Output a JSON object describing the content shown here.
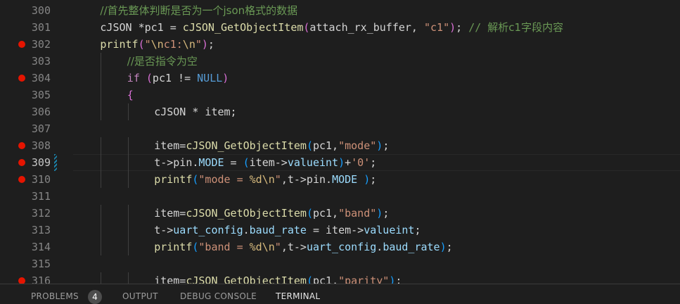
{
  "editor": {
    "lines": [
      {
        "number": "300",
        "breakpoint": false,
        "indent": "    ",
        "segments": [
          {
            "t": "//首先整体判断是否为一个json格式的数据",
            "c": "cm"
          }
        ]
      },
      {
        "number": "301",
        "breakpoint": false,
        "indent": "    ",
        "segments": [
          {
            "t": "cJSON *pc1 = ",
            "c": ""
          },
          {
            "t": "cJSON_GetObjectItem",
            "c": "fn"
          },
          {
            "t": "(",
            "c": "br"
          },
          {
            "t": "attach_rx_buffer, ",
            "c": ""
          },
          {
            "t": "\"c1\"",
            "c": "st"
          },
          {
            "t": ")",
            "c": "br"
          },
          {
            "t": "; ",
            "c": ""
          },
          {
            "t": "// ",
            "c": "cmm"
          },
          {
            "t": "解析c1字段内容",
            "c": "cm"
          }
        ]
      },
      {
        "number": "302",
        "breakpoint": true,
        "indent": "    ",
        "segments": [
          {
            "t": "printf",
            "c": "fn"
          },
          {
            "t": "(",
            "c": "br"
          },
          {
            "t": "\"",
            "c": "st"
          },
          {
            "t": "\\n",
            "c": "esc"
          },
          {
            "t": "c1:",
            "c": "st"
          },
          {
            "t": "\\n",
            "c": "esc"
          },
          {
            "t": "\"",
            "c": "st"
          },
          {
            "t": ")",
            "c": "br"
          },
          {
            "t": ";",
            "c": ""
          }
        ]
      },
      {
        "number": "303",
        "breakpoint": false,
        "indent": "        ",
        "segments": [
          {
            "t": "//是否指令为空",
            "c": "cm"
          }
        ]
      },
      {
        "number": "304",
        "breakpoint": true,
        "indent": "        ",
        "segments": [
          {
            "t": "if",
            "c": "kw"
          },
          {
            "t": " (",
            "c": "br"
          },
          {
            "t": "pc1 != ",
            "c": ""
          },
          {
            "t": "NULL",
            "c": "cn"
          },
          {
            "t": ")",
            "c": "br"
          }
        ]
      },
      {
        "number": "305",
        "breakpoint": false,
        "indent": "        ",
        "segments": [
          {
            "t": "{",
            "c": "br"
          }
        ]
      },
      {
        "number": "306",
        "breakpoint": false,
        "indent": "            ",
        "segments": [
          {
            "t": "cJSON * item;",
            "c": ""
          }
        ]
      },
      {
        "number": "307",
        "breakpoint": false,
        "indent": "",
        "segments": []
      },
      {
        "number": "308",
        "breakpoint": true,
        "indent": "            ",
        "segments": [
          {
            "t": "item=",
            "c": ""
          },
          {
            "t": "cJSON_GetObjectItem",
            "c": "fn"
          },
          {
            "t": "(",
            "c": "bl"
          },
          {
            "t": "pc1,",
            "c": ""
          },
          {
            "t": "\"mode\"",
            "c": "st"
          },
          {
            "t": ")",
            "c": "bl"
          },
          {
            "t": ";",
            "c": ""
          }
        ]
      },
      {
        "number": "309",
        "breakpoint": true,
        "active": true,
        "modified": true,
        "indent": "            ",
        "segments": [
          {
            "t": "t->pin.",
            "c": ""
          },
          {
            "t": "MODE",
            "c": "vr"
          },
          {
            "t": " = ",
            "c": ""
          },
          {
            "t": "(",
            "c": "bl"
          },
          {
            "t": "item->",
            "c": ""
          },
          {
            "t": "valueint",
            "c": "vr"
          },
          {
            "t": ")",
            "c": "bl"
          },
          {
            "t": "+",
            "c": ""
          },
          {
            "t": "'0'",
            "c": "st"
          },
          {
            "t": ";",
            "c": ""
          }
        ]
      },
      {
        "number": "310",
        "breakpoint": true,
        "indent": "            ",
        "segments": [
          {
            "t": "printf",
            "c": "fn"
          },
          {
            "t": "(",
            "c": "bl"
          },
          {
            "t": "\"mode = ",
            "c": "st"
          },
          {
            "t": "%d\\n",
            "c": "esc"
          },
          {
            "t": "\"",
            "c": "st"
          },
          {
            "t": ",t->pin.",
            "c": ""
          },
          {
            "t": "MODE",
            "c": "vr"
          },
          {
            "t": " ",
            "c": ""
          },
          {
            "t": ")",
            "c": "bl"
          },
          {
            "t": ";",
            "c": ""
          }
        ]
      },
      {
        "number": "311",
        "breakpoint": false,
        "indent": "",
        "segments": []
      },
      {
        "number": "312",
        "breakpoint": false,
        "indent": "            ",
        "segments": [
          {
            "t": "item=",
            "c": ""
          },
          {
            "t": "cJSON_GetObjectItem",
            "c": "fn"
          },
          {
            "t": "(",
            "c": "bl"
          },
          {
            "t": "pc1,",
            "c": ""
          },
          {
            "t": "\"band\"",
            "c": "st"
          },
          {
            "t": ")",
            "c": "bl"
          },
          {
            "t": ";",
            "c": ""
          }
        ]
      },
      {
        "number": "313",
        "breakpoint": false,
        "indent": "            ",
        "segments": [
          {
            "t": "t->",
            "c": ""
          },
          {
            "t": "uart_config",
            "c": "vr"
          },
          {
            "t": ".",
            "c": ""
          },
          {
            "t": "baud_rate",
            "c": "vr"
          },
          {
            "t": " = item->",
            "c": ""
          },
          {
            "t": "valueint",
            "c": "vr"
          },
          {
            "t": ";",
            "c": ""
          }
        ]
      },
      {
        "number": "314",
        "breakpoint": false,
        "indent": "            ",
        "segments": [
          {
            "t": "printf",
            "c": "fn"
          },
          {
            "t": "(",
            "c": "bl"
          },
          {
            "t": "\"band = ",
            "c": "st"
          },
          {
            "t": "%d\\n",
            "c": "esc"
          },
          {
            "t": "\"",
            "c": "st"
          },
          {
            "t": ",t->",
            "c": ""
          },
          {
            "t": "uart_config",
            "c": "vr"
          },
          {
            "t": ".",
            "c": ""
          },
          {
            "t": "baud_rate",
            "c": "vr"
          },
          {
            "t": ")",
            "c": "bl"
          },
          {
            "t": ";",
            "c": ""
          }
        ]
      },
      {
        "number": "315",
        "breakpoint": false,
        "indent": "",
        "segments": []
      },
      {
        "number": "316",
        "breakpoint": true,
        "indent": "            ",
        "segments": [
          {
            "t": "item=",
            "c": ""
          },
          {
            "t": "cJSON_GetObjectItem",
            "c": "fn"
          },
          {
            "t": "(",
            "c": "bl"
          },
          {
            "t": "pc1,",
            "c": ""
          },
          {
            "t": "\"parity\"",
            "c": "st"
          },
          {
            "t": ")",
            "c": "bl"
          },
          {
            "t": ";",
            "c": ""
          }
        ]
      }
    ]
  },
  "panel": {
    "tabs": [
      {
        "label": "PROBLEMS",
        "active": false
      },
      {
        "label": "OUTPUT",
        "active": false
      },
      {
        "label": "DEBUG CONSOLE",
        "active": false
      },
      {
        "label": "TERMINAL",
        "active": true
      }
    ],
    "problems_count": "4"
  },
  "colors": {
    "background": "#1e1e1e",
    "breakpoint": "#e51400",
    "comment": "#6a9955",
    "function": "#dcdcaa",
    "string": "#ce9178",
    "keyword": "#c586c0",
    "constant": "#569cd6",
    "variable": "#9cdcfe"
  }
}
